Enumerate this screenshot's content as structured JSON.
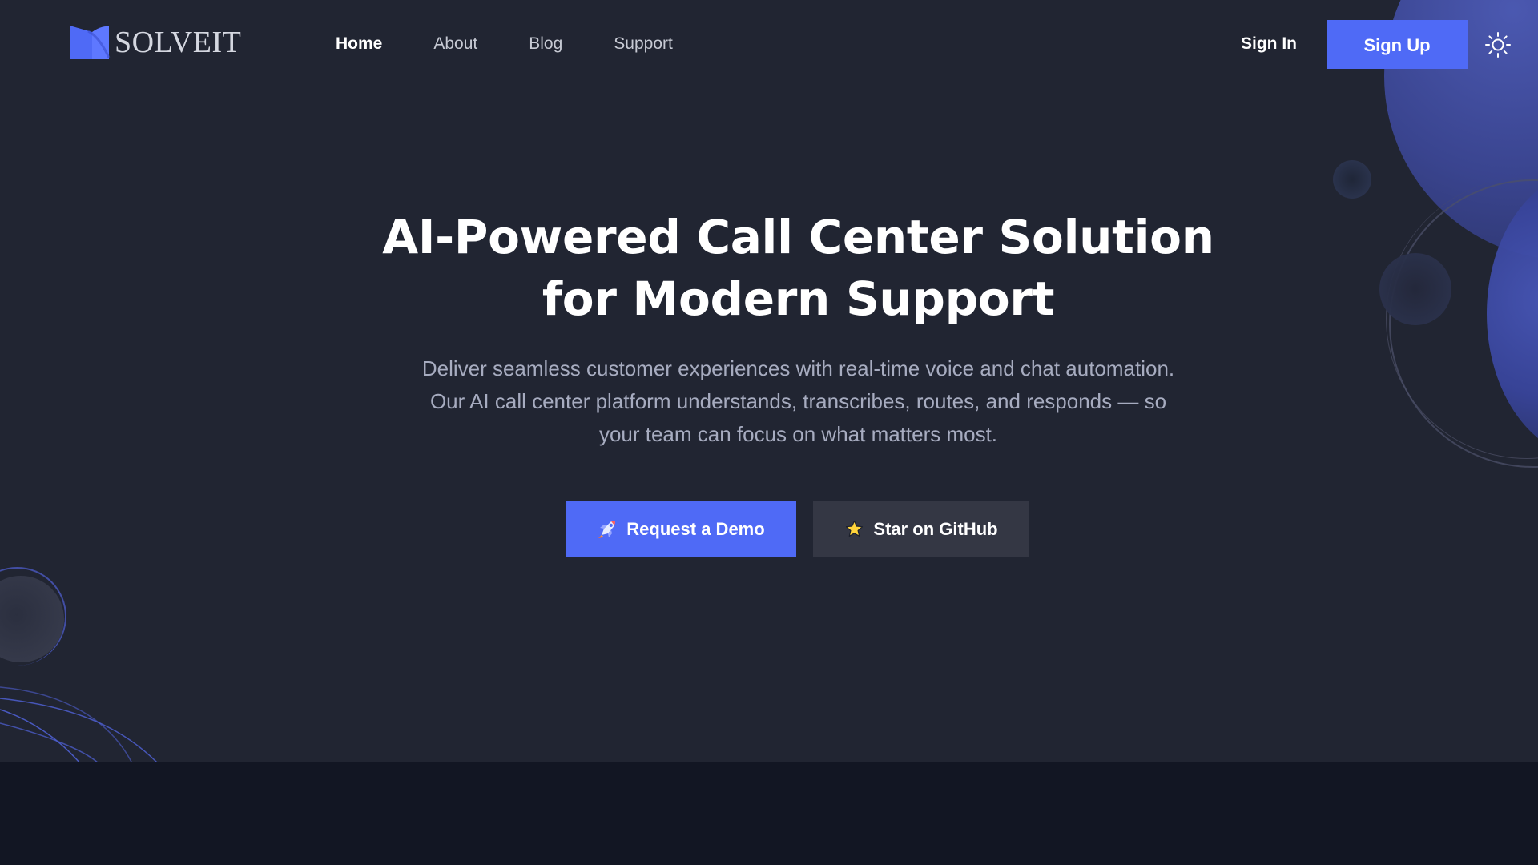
{
  "brand": {
    "name": "SOLVEIT",
    "logo_icon": "book-logo-icon",
    "accent": "#4f6af6"
  },
  "header": {
    "nav_items": [
      {
        "label": "Home",
        "active": true
      },
      {
        "label": "About",
        "active": false
      },
      {
        "label": "Blog",
        "active": false
      },
      {
        "label": "Support",
        "active": false
      }
    ],
    "sign_in": "Sign In",
    "sign_up": "Sign Up",
    "theme_toggle_icon": "sun-icon"
  },
  "hero": {
    "title_line_1": "AI-Powered Call Center Solution",
    "title_line_2": "for Modern Support",
    "subtitle_line_1": "Deliver seamless customer experiences with real-time voice and chat automation.",
    "subtitle_line_2": "Our AI call center platform understands, transcribes, routes, and responds — so",
    "subtitle_line_3": "your team can focus on what matters most.",
    "primary_cta": {
      "label": "Request a Demo",
      "icon": "rocket-icon"
    },
    "secondary_cta": {
      "label": "Star on GitHub",
      "icon": "star-icon"
    }
  },
  "colors": {
    "background": "#212532",
    "lower_background": "#121623",
    "primary": "#4f6af6",
    "secondary_button": "#343744",
    "heading": "#ffffff",
    "subtitle": "#a7acc0",
    "nav_text": "#c7cad4",
    "decor_blue": "#3b4694"
  }
}
